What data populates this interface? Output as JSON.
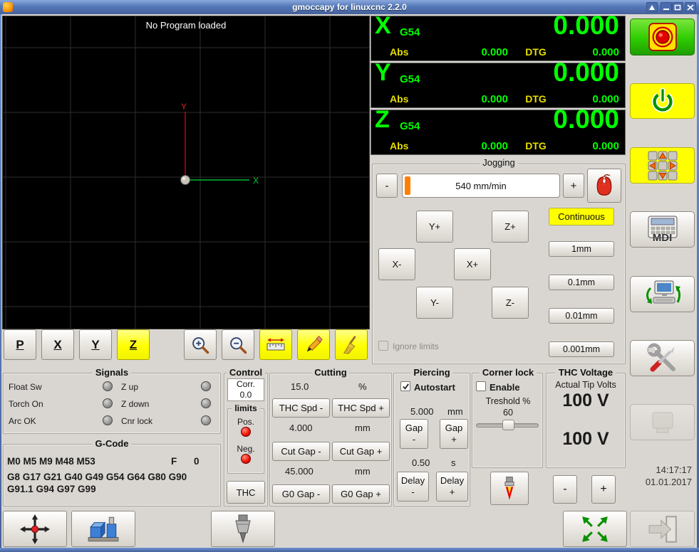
{
  "window": {
    "title": "gmoccapy for linuxcnc  2.2.0"
  },
  "preview": {
    "status": "No Program loaded",
    "x_axis_label": "X",
    "y_axis_label": "Y",
    "toolbar": {
      "p": "P",
      "x": "X",
      "y": "Y",
      "z": "Z"
    }
  },
  "dro": {
    "axes": [
      {
        "letter": "X",
        "system": "G54",
        "value": "0.000",
        "abs_label": "Abs",
        "abs": "0.000",
        "dtg_label": "DTG",
        "dtg": "0.000"
      },
      {
        "letter": "Y",
        "system": "G54",
        "value": "0.000",
        "abs_label": "Abs",
        "abs": "0.000",
        "dtg_label": "DTG",
        "dtg": "0.000"
      },
      {
        "letter": "Z",
        "system": "G54",
        "value": "0.000",
        "abs_label": "Abs",
        "abs": "0.000",
        "dtg_label": "DTG",
        "dtg": "0.000"
      }
    ]
  },
  "jogging": {
    "title": "Jogging",
    "speed_minus": "-",
    "speed_plus": "+",
    "speed_value": "540 mm/min",
    "continuous": "Continuous",
    "jog": {
      "y_plus": "Y+",
      "z_plus": "Z+",
      "x_minus": "X-",
      "x_plus": "X+",
      "y_minus": "Y-",
      "z_minus": "Z-"
    },
    "increments": [
      "1mm",
      "0.1mm",
      "0.01mm",
      "0.001mm"
    ],
    "ignore_limits": "Ignore limits"
  },
  "signals": {
    "title": "Signals",
    "left": [
      {
        "label": "Float Sw"
      },
      {
        "label": "Torch On"
      },
      {
        "label": "Arc OK"
      }
    ],
    "right": [
      {
        "label": "Z up"
      },
      {
        "label": "Z down"
      },
      {
        "label": "Cnr lock"
      }
    ]
  },
  "gcode": {
    "title": "G-Code",
    "m_codes": "M0 M5 M9 M48 M53",
    "f_label": "F",
    "f_value": "0",
    "g_codes": "G8 G17 G21 G40 G49 G54 G64 G80 G90 G91.1 G94 G97 G99"
  },
  "control": {
    "title": "Control",
    "corr_label": "Corr.",
    "corr_value": "0.0",
    "limits_title": "limits",
    "pos_label": "Pos.",
    "neg_label": "Neg.",
    "thc_button": "THC"
  },
  "cutting": {
    "title": "Cutting",
    "feed_value": "15.0",
    "feed_unit": "%",
    "thc_spd_minus": "THC Spd -",
    "thc_spd_plus": "THC Spd +",
    "cut_gap_value": "4.000",
    "cut_gap_unit": "mm",
    "cut_gap_minus": "Cut Gap -",
    "cut_gap_plus": "Cut Gap +",
    "g0_gap_value": "45.000",
    "g0_gap_unit": "mm",
    "g0_gap_minus": "G0 Gap -",
    "g0_gap_plus": "G0 Gap +"
  },
  "piercing": {
    "title": "Piercing",
    "autostart": "Autostart",
    "gap_value": "5.000",
    "gap_unit": "mm",
    "gap_minus": "Gap\n-",
    "gap_plus": "Gap\n+",
    "delay_value": "0.50",
    "delay_unit": "s",
    "delay_minus": "Delay\n-",
    "delay_plus": "Delay\n+"
  },
  "corner_lock": {
    "title": "Corner lock",
    "enable": "Enable",
    "threshold_label": "Treshold %",
    "threshold_value": "60"
  },
  "thc": {
    "title": "THC Voltage",
    "actual_label": "Actual Tip Volts",
    "actual_value": "100 V",
    "target_value": "100 V",
    "volt_minus": "-",
    "volt_plus": "+"
  },
  "right_column": {
    "mdi_label": "MDI",
    "time": "14:17:17",
    "date": "01.01.2017"
  },
  "colors": {
    "dro_green": "#00ff00",
    "dro_label_yellow": "#e6df00",
    "accent_yellow": "#ffff00",
    "estop_green": "#2ecc00",
    "led_red": "#f01000",
    "slider_orange": "#ff8000",
    "titlebar_blue": "#5479b8"
  }
}
